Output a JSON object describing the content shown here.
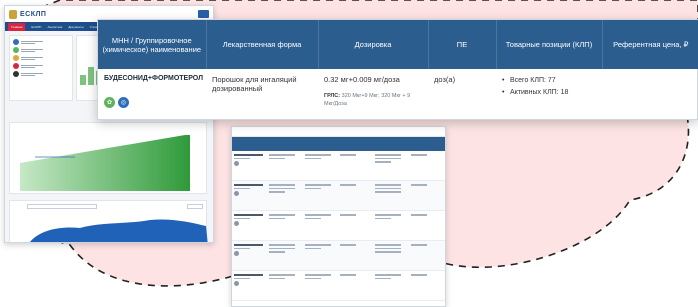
{
  "colors": {
    "header_blue": "#2b5d8f",
    "brand_blue": "#1f4e8c",
    "accent_red": "#d7263d",
    "blob_pink": "#fde3e3",
    "icon_green": "#5fb35f",
    "icon_blue": "#2f6fb7"
  },
  "dashboard": {
    "logo": "ЕСКЛП",
    "nav_items": [
      "Главная",
      "ЕСКЛП",
      "Аналитика",
      "Документы",
      "Справочник"
    ]
  },
  "table": {
    "headers": [
      "МНН / Группировочное (химическое) наименование",
      "Лекарственная форма",
      "Дозировка",
      "ПЕ",
      "Товарные позиции (КЛП)",
      "Референтная цена, ₽"
    ],
    "row": {
      "name": "БУДЕСОНИД+ФОРМОТЕРОЛ",
      "icons": [
        "leaf-icon",
        "globe-icon"
      ],
      "form": "Порошок для ингаляций дозированный",
      "dosage": "0.32 мг+0.009 мг/доза",
      "grls_label": "ГРЛС:",
      "grls_value": "320 Мкг+9 Мкг; 320 Мкг + 9 Мкг/Доза",
      "unit": "доз(а)",
      "positions": [
        "Всего КЛП: 77",
        "Активных КЛП: 18"
      ]
    }
  }
}
